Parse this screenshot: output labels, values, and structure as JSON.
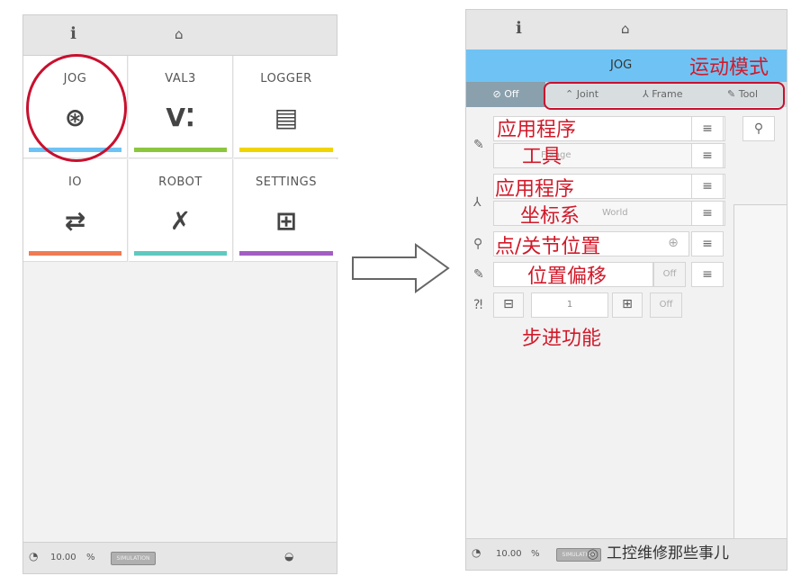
{
  "left_panel": {
    "topbar_icons": [
      "info-icon",
      "robot-arm-icon"
    ],
    "tiles": [
      {
        "label": "JOG",
        "icon": "jog-icon",
        "color": "#6ec3f4"
      },
      {
        "label": "VAL3",
        "icon": "val3-icon",
        "color": "#8cc63f"
      },
      {
        "label": "LOGGER",
        "icon": "document-icon",
        "color": "#f0d500"
      },
      {
        "label": "IO",
        "icon": "io-arrows-icon",
        "color": "#f07b52"
      },
      {
        "label": "ROBOT",
        "icon": "tools-icon",
        "color": "#5fc9c0"
      },
      {
        "label": "SETTINGS",
        "icon": "sliders-icon",
        "color": "#a45ec3"
      }
    ],
    "status": {
      "speed": "10.00",
      "unit": "%",
      "chip": "SIMULATION"
    }
  },
  "right_panel": {
    "header": "JOG",
    "off_label": "⊘ Off",
    "modes": [
      "Joint",
      "Frame",
      "Tool"
    ],
    "rows": {
      "tool_value": "Flange",
      "frame_value": "World",
      "position_off": "Off",
      "step_value": "1",
      "step_off": "Off"
    },
    "status": {
      "speed": "10.00",
      "unit": "%",
      "chip": "SIMULATION"
    }
  },
  "annotations": {
    "motion_mode": "运动模式",
    "app_program_1": "应用程序",
    "tool": "工具",
    "app_program_2": "应用程序",
    "coordinate_system": "坐标系",
    "point_joint_position": "点/关节位置",
    "position_offset": "位置偏移",
    "step_function": "步进功能"
  },
  "watermark": "工控维修那些事儿",
  "colors": {
    "highlight_red": "#c8102e",
    "jog_blue": "#6ec3f4"
  }
}
